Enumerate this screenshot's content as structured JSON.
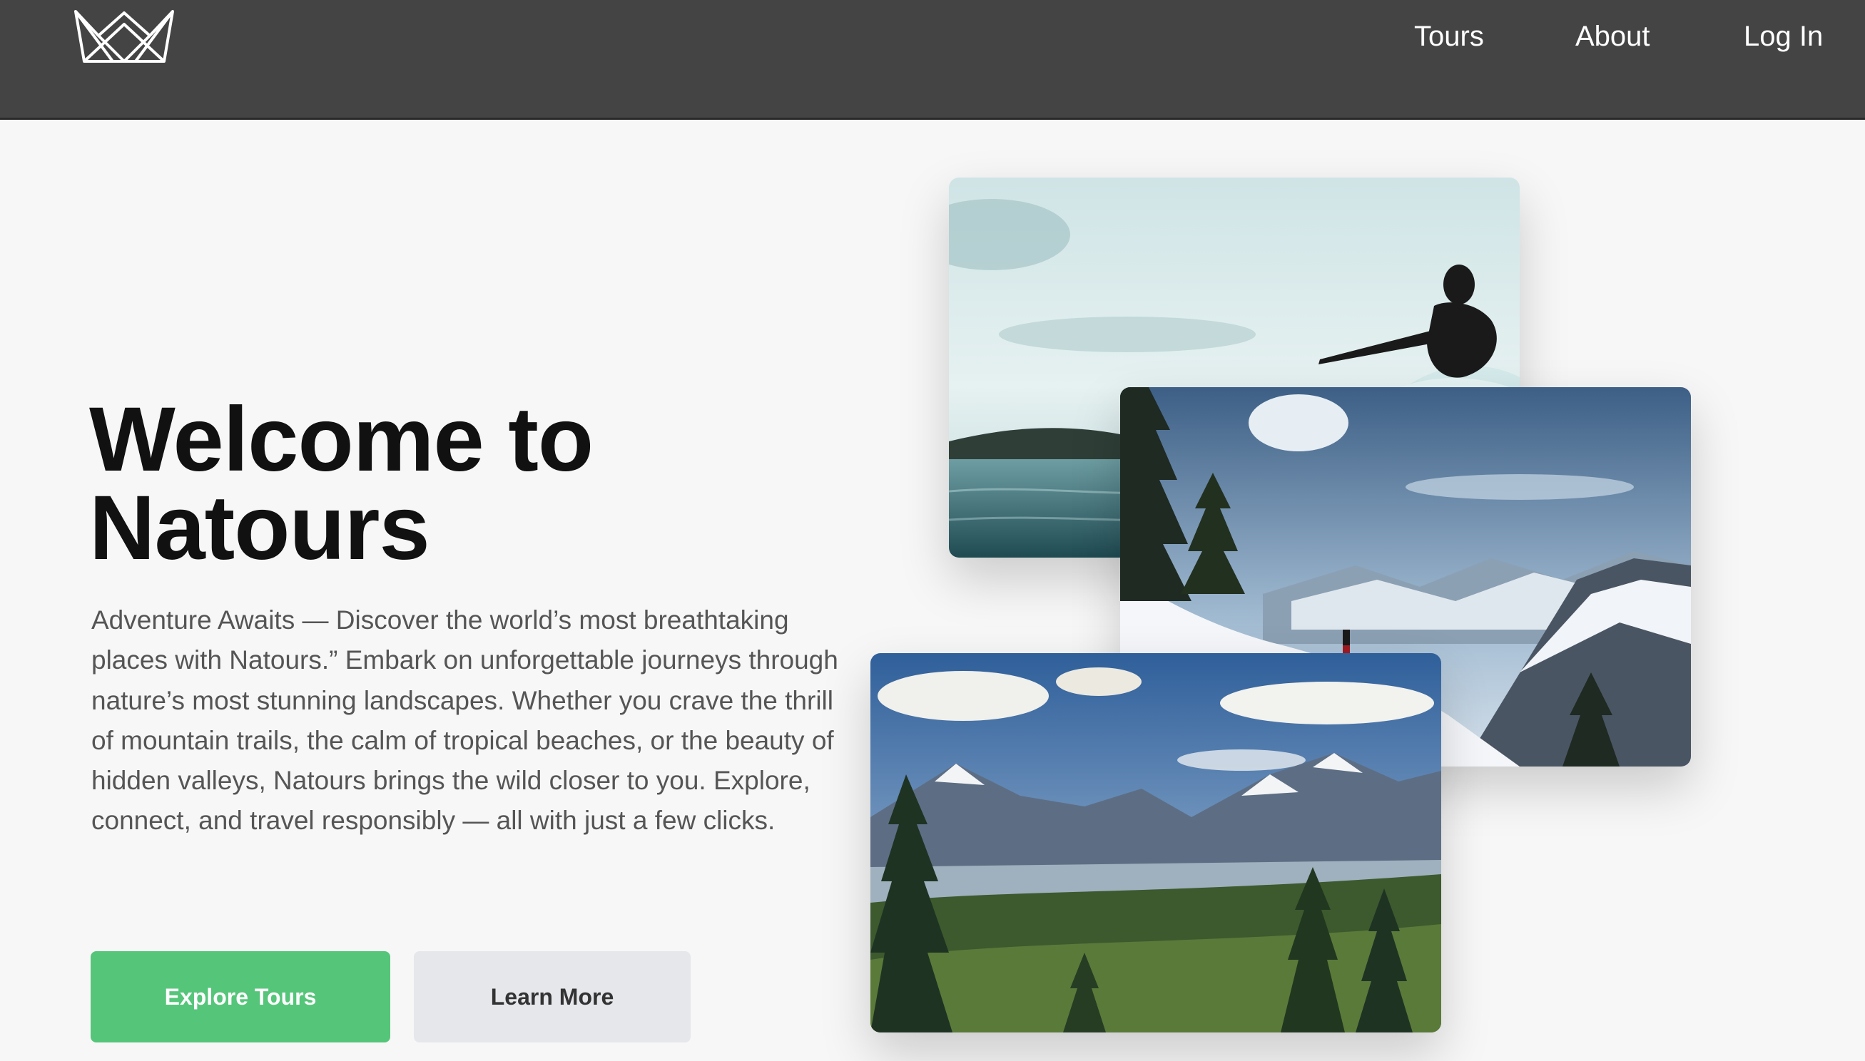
{
  "nav": {
    "logo_icon": "crown-logo-icon",
    "links": [
      "Tours",
      "About",
      "Log In"
    ]
  },
  "hero": {
    "title_line1": "Welcome to",
    "title_line2": "Natours",
    "description": "Adventure Awaits — Discover the world’s most breathtaking places with Natours.” Embark on unforgettable journeys through nature’s most stunning landscapes. Whether you crave the thrill of mountain trails, the calm of tropical beaches, or the beauty of hidden valleys, Natours brings the wild closer to you. Explore, connect, and travel responsibly — all with just a few clicks.",
    "buttons": {
      "primary": "Explore Tours",
      "secondary": "Learn More"
    }
  },
  "gallery": {
    "images": [
      "surfer-photo",
      "snowy-mountain-hiker-photo",
      "mountain-valley-forest-photo"
    ]
  },
  "colors": {
    "navbar": "#444444",
    "accent_green": "#55c57a",
    "secondary_button": "#e5e7eb",
    "page_background": "#f7f7f7"
  }
}
